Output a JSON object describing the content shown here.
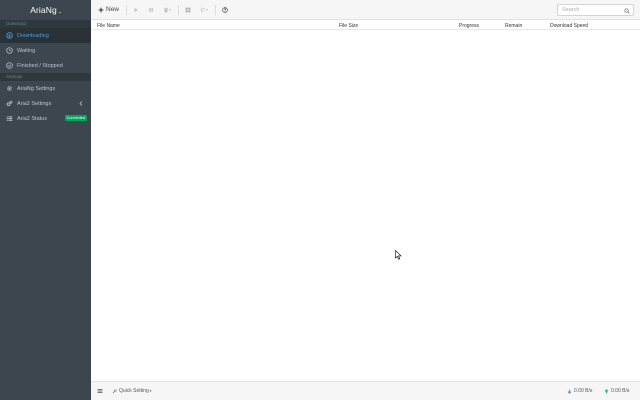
{
  "app": {
    "title": "AriaNg"
  },
  "sidebar": {
    "download_section": "Download",
    "settings_section": "Settings",
    "items": [
      {
        "label": "Downloading",
        "icon": "circle-arrow-down-icon",
        "active": true
      },
      {
        "label": "Waiting",
        "icon": "clock-icon",
        "active": false
      },
      {
        "label": "Finished / Stopped",
        "icon": "check-circle-icon",
        "active": false
      }
    ],
    "settings_items": [
      {
        "label": "AriaNg Settings",
        "icon": "gear-icon"
      },
      {
        "label": "Aria2 Settings",
        "icon": "gears-icon"
      },
      {
        "label": "Aria2 Status",
        "icon": "tasks-icon",
        "badge": "Connected"
      }
    ]
  },
  "toolbar": {
    "new_label": "New",
    "search_placeholder": "Search"
  },
  "table": {
    "columns": [
      "File Name",
      "File Size",
      "Progress",
      "Remain",
      "Download Speed"
    ]
  },
  "footer": {
    "quick_setting": "Quick Setting",
    "download_speed": "0.00 B/s",
    "upload_speed": "0.00 B/s"
  },
  "colors": {
    "sidebar_bg": "#3b464f",
    "active_text": "#4a9fe0",
    "badge_bg": "#00a65a",
    "download_arrow": "#3c8dbc",
    "upload_arrow": "#00a65a"
  }
}
